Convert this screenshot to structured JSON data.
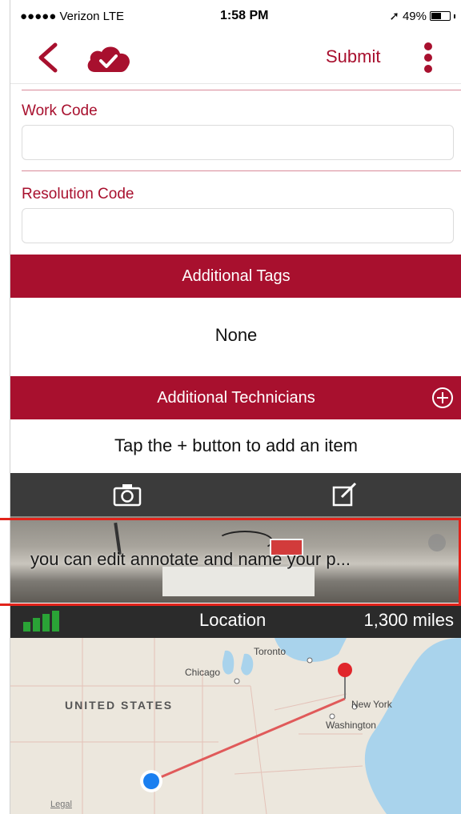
{
  "status_bar": {
    "carrier": "●●●●● Verizon  LTE",
    "time": "1:58 PM",
    "battery": "49%",
    "battery_level": 0.49
  },
  "nav": {
    "submit_label": "Submit",
    "back_icon": "chevron-left-icon",
    "cloud_icon": "cloud-check-icon",
    "more_icon": "vertical-dots-icon",
    "accent_color": "#a8102e"
  },
  "form": {
    "work_code_label": "Work Code",
    "work_code_value": "",
    "resolution_code_label": "Resolution Code",
    "resolution_code_value": ""
  },
  "additional_tags": {
    "header": "Additional Tags",
    "value": "None"
  },
  "additional_technicians": {
    "header": "Additional Technicians",
    "empty_text": "Tap the + button to add an item",
    "add_icon": "plus-circle-icon"
  },
  "toolbar": {
    "camera_icon": "camera-icon",
    "edit_icon": "edit-icon"
  },
  "photo": {
    "caption": "you can edit annotate and name your p..."
  },
  "location": {
    "label": "Location",
    "distance": "1,300 miles",
    "signal_icon": "signal-bars-icon"
  },
  "map": {
    "country": "UNITED STATES",
    "cities": [
      "Toronto",
      "Chicago",
      "New York",
      "Washington"
    ],
    "legal": "Legal"
  }
}
